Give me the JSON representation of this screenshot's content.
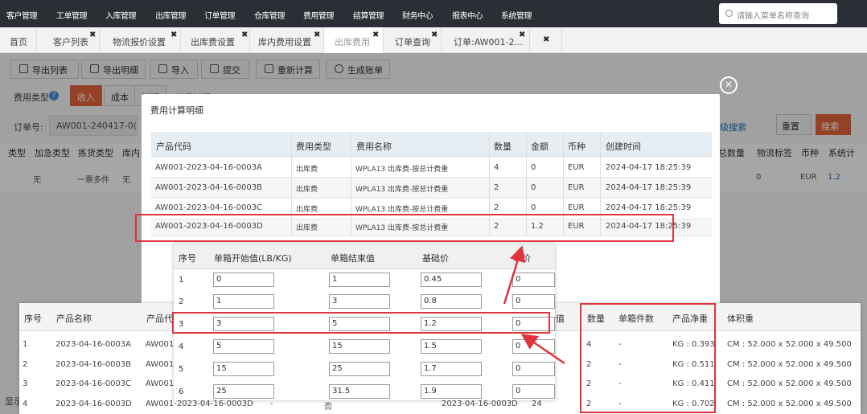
{
  "topnav": {
    "items": [
      "客户管理",
      "工单管理",
      "入库管理",
      "出库管理",
      "订单管理",
      "仓库管理",
      "费用管理",
      "结算管理",
      "财务中心",
      "报表中心",
      "系统管理"
    ],
    "search_placeholder": "请输入菜单名称查询"
  },
  "tabs": [
    {
      "label": "首页",
      "closable": false
    },
    {
      "label": "客户列表",
      "closable": true
    },
    {
      "label": "物流报价设置",
      "closable": true
    },
    {
      "label": "出库费设置",
      "closable": true
    },
    {
      "label": "库内费用设置",
      "closable": true
    },
    {
      "label": "出库费用",
      "closable": true,
      "active": true
    },
    {
      "label": "订单查询",
      "closable": true
    },
    {
      "label": "订单:AW001-2...",
      "closable": true
    },
    {
      "label": "",
      "closable": true
    }
  ],
  "toolbar": {
    "export_list": "导出列表",
    "export_detail": "导出明细",
    "import": "导入",
    "submit": "提交",
    "recalc": "重新计算",
    "generate_bill": "生成账单"
  },
  "filters": {
    "fee_type_label": "费用类型",
    "income": "收入",
    "cost": "成本",
    "partial_a": "料班",
    "partial_b": "当级时间",
    "order_no_label": "订单号:",
    "order_no_value": "AW001-240417-0(",
    "advanced_search": "级搜索",
    "reset": "重置",
    "search": "搜索"
  },
  "bg_table": {
    "headers_left": [
      "类型",
      "加急类型",
      "拣货类型",
      "库内"
    ],
    "row_left": [
      "无",
      "一票多件",
      "无"
    ],
    "headers_right": [
      "总数量",
      "物流标签",
      "币种",
      "系统计"
    ],
    "row_right": [
      "0",
      "EUR",
      "1.2"
    ],
    "footer_left": "显示"
  },
  "modal": {
    "title": "费用计算明细",
    "close": "×",
    "headers": [
      "产品代码",
      "费用类型",
      "费用名称",
      "数量",
      "金额",
      "币种",
      "创建时间"
    ],
    "rows": [
      [
        "AW001-2023-04-16-0003A",
        "出库费",
        "WPLA13 出库费-按总计费重",
        "4",
        "0",
        "EUR",
        "2024-04-17 18:25:39"
      ],
      [
        "AW001-2023-04-16-0003B",
        "出库费",
        "WPLA13 出库费-按总计费重",
        "2",
        "0",
        "EUR",
        "2024-04-17 18:25:39"
      ],
      [
        "AW001-2023-04-16-0003C",
        "出库费",
        "WPLA13 出库费-按总计费重",
        "2",
        "0",
        "EUR",
        "2024-04-17 18:25:39"
      ],
      [
        "AW001-2023-04-16-0003D",
        "出库费",
        "WPLA13 出库费-按总计费重",
        "2",
        "1.2",
        "EUR",
        "2024-04-17 18:25:39"
      ]
    ]
  },
  "rate_panel": {
    "headers": [
      "序号",
      "单箱开始值(LB/KG)",
      "单箱结束值",
      "基础价",
      "单价"
    ],
    "rows": [
      [
        "1",
        "0",
        "1",
        "0.45",
        "0"
      ],
      [
        "2",
        "1",
        "3",
        "0.8",
        "0"
      ],
      [
        "3",
        "3",
        "5",
        "1.2",
        "0"
      ],
      [
        "4",
        "5",
        "15",
        "1.5",
        "0"
      ],
      [
        "5",
        "15",
        "25",
        "1.7",
        "0"
      ],
      [
        "6",
        "25",
        "31.5",
        "1.9",
        "0"
      ]
    ]
  },
  "product_table": {
    "headers": [
      "序号",
      "产品名称",
      "产品代",
      "值",
      "数量",
      "单箱件数",
      "产品净重",
      "体积重"
    ],
    "rows": [
      {
        "no": "1",
        "name": "2023-04-16-0003A",
        "code": "AW001-",
        "qty": "4",
        "per_box": "-",
        "weight": "KG : 0.393",
        "volume": "CM : 52.000 x 52.000 x 49.500"
      },
      {
        "no": "2",
        "name": "2023-04-16-0003B",
        "code": "AW001-",
        "qty": "2",
        "per_box": "-",
        "weight": "KG : 0.511",
        "volume": "CM : 52.000 x 52.000 x 49.500"
      },
      {
        "no": "3",
        "name": "2023-04-16-0003C",
        "code": "AW001-",
        "qty": "2",
        "per_box": "-",
        "weight": "KG : 0.411",
        "volume": "CM : 52.000 x 52.000 x 49.500"
      },
      {
        "no": "4",
        "name": "2023-04-16-0003D",
        "code": "AW001-2023-04-16-0003D",
        "dash": "-",
        "flag": "否",
        "code2": "2023-04-16-0003D",
        "val": "24",
        "qty": "2",
        "per_box": "-",
        "weight": "KG : 0.702",
        "volume": "CM : 52.000 x 52.000 x 49.500"
      }
    ]
  },
  "colors": {
    "accent": "#e4643b",
    "highlight": "#e0333a",
    "nav_bg": "#2b2f35",
    "link": "#1a6fc9"
  }
}
